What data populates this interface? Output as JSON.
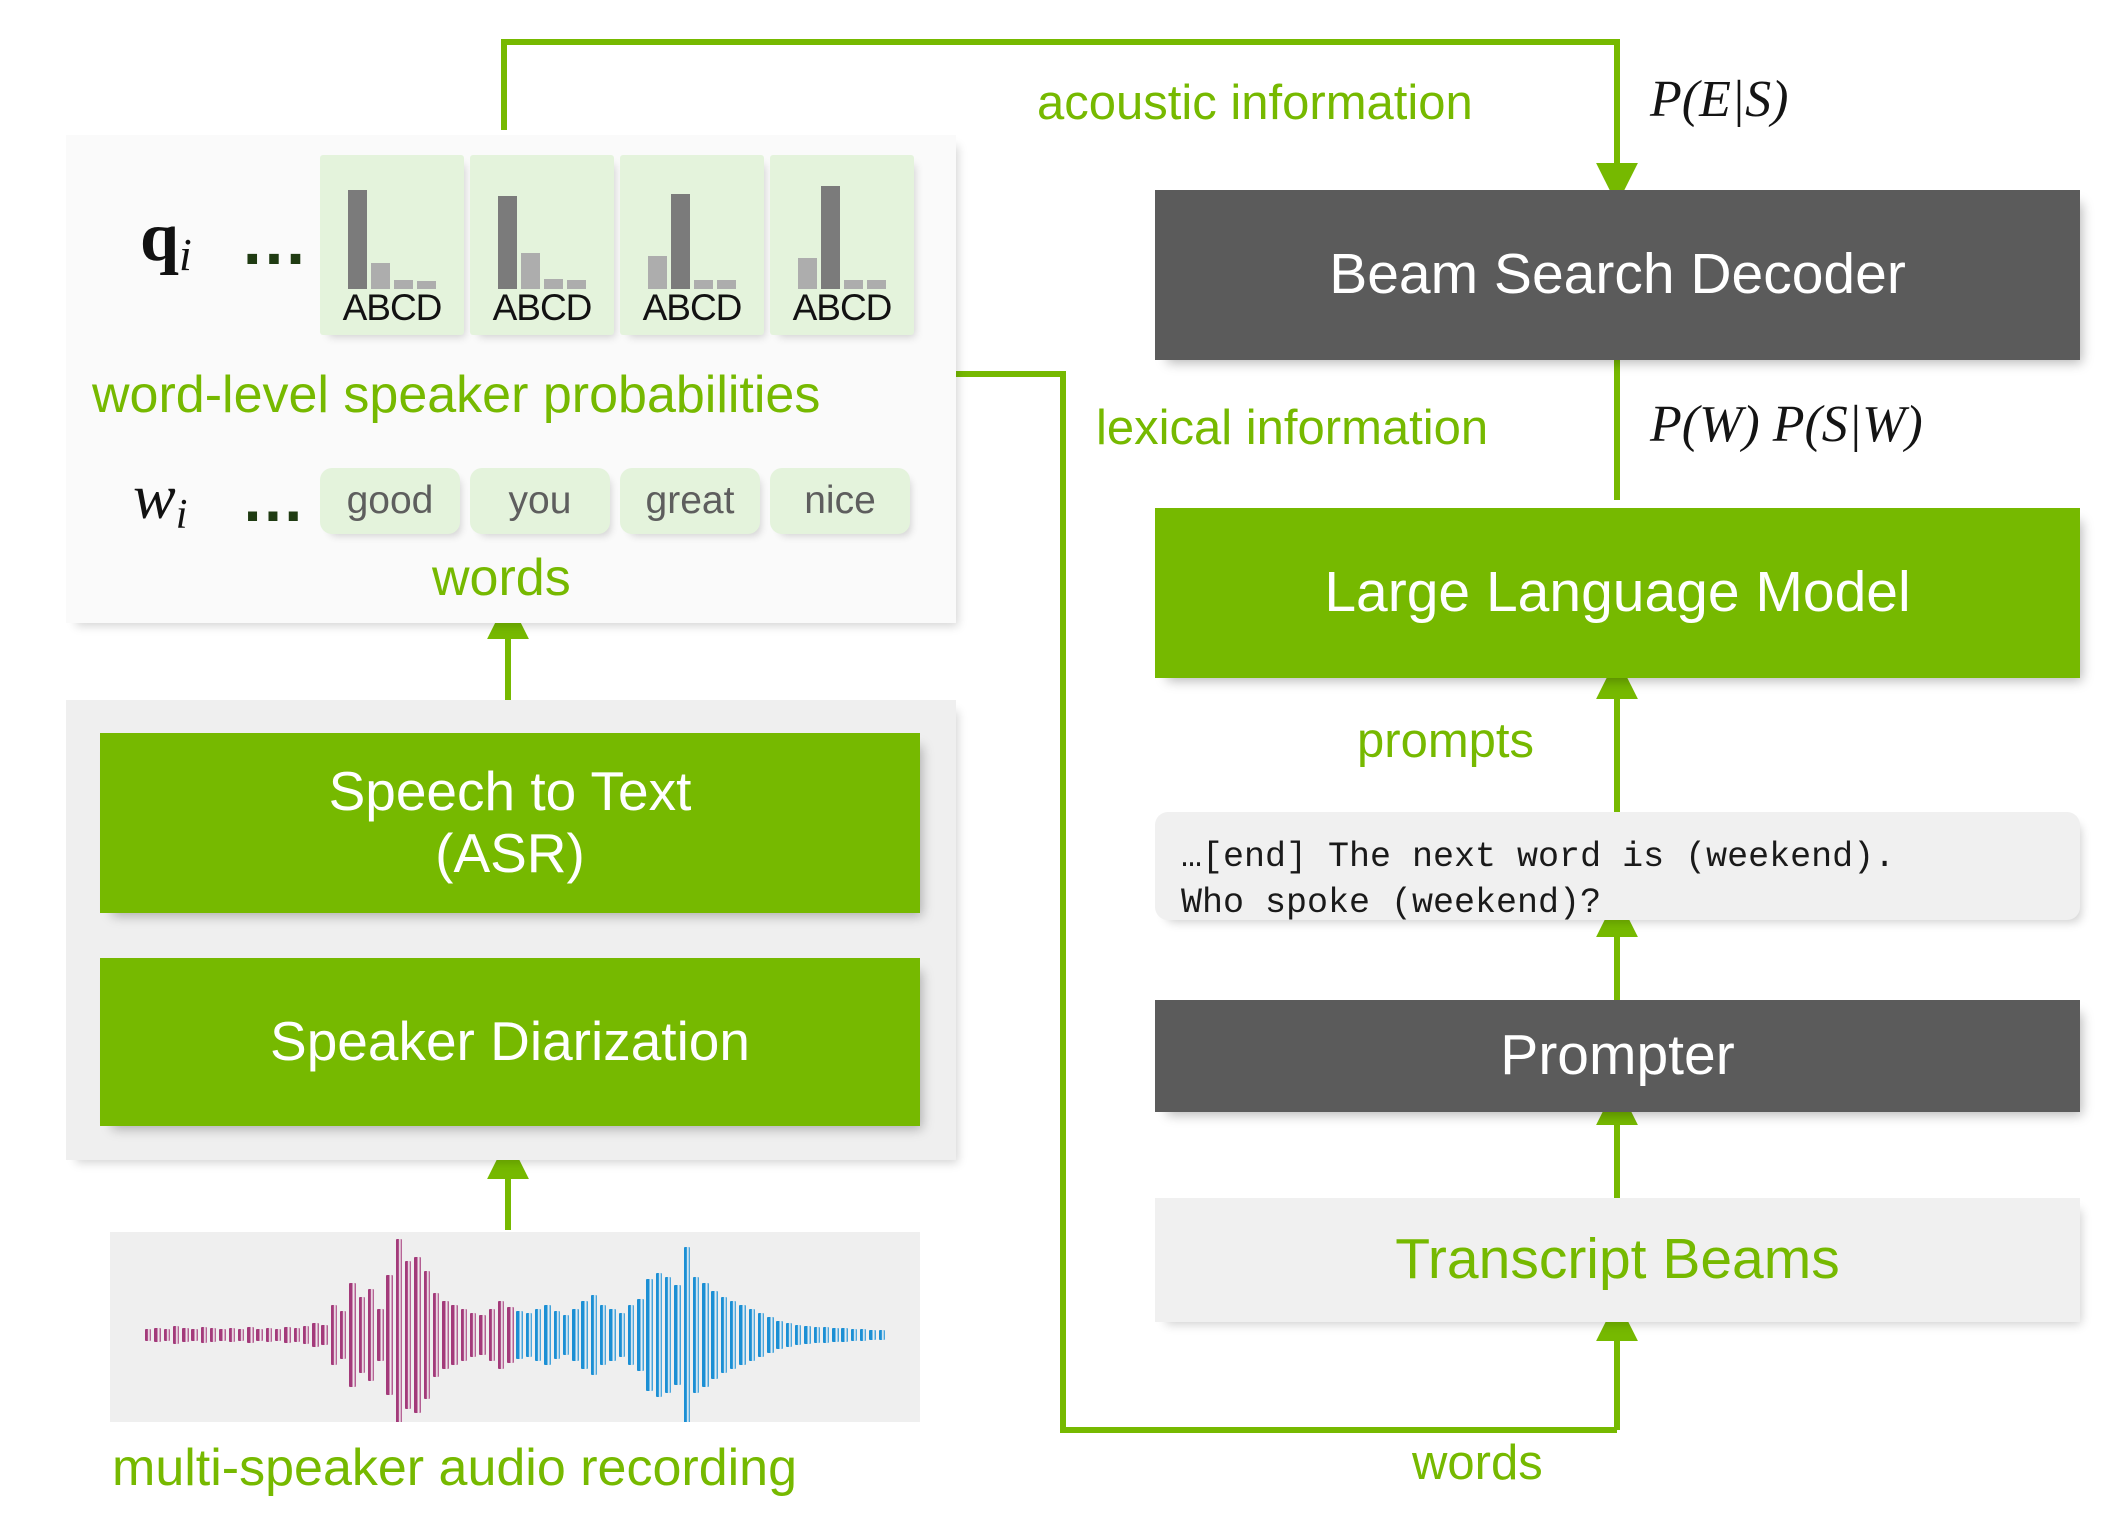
{
  "colors": {
    "green": "#76B900",
    "dark_box": "#5B5B5B",
    "pale_chip": "#E4F3DC",
    "panel_grey": "#EFEFEF",
    "bar_high": "#7B7B7B",
    "bar_low": "#ADADAD",
    "wave_speaker_a": "#A33A7A",
    "wave_speaker_b": "#1B8FD4"
  },
  "left_column": {
    "outputs_panel": {
      "q_symbol": "q",
      "q_subscript": "i",
      "q_ellipsis": "…",
      "w_symbol": "w",
      "w_subscript": "i",
      "w_ellipsis": "…",
      "probabilities_caption": "word-level speaker probabilities",
      "words_caption": "words",
      "histogram_axis_label": "ABCD",
      "word_chips": [
        "good",
        "you",
        "great",
        "nice"
      ]
    },
    "pipeline": {
      "speech_to_text_line1": "Speech to Text",
      "speech_to_text_line2": "(ASR)",
      "speaker_diarization": "Speaker Diarization"
    },
    "audio": {
      "caption": "multi-speaker audio recording"
    }
  },
  "right_column": {
    "beam_search_decoder": "Beam Search Decoder",
    "large_language_model": "Large Language Model",
    "prompter": "Prompter",
    "transcript_beams": "Transcript Beams",
    "prompt_text_line1": "…[end] The next word is (weekend).",
    "prompt_text_line2": "Who spoke (weekend)?"
  },
  "edge_labels": {
    "acoustic_information": "acoustic information",
    "acoustic_formula": "P(E|S)",
    "lexical_information": "lexical information",
    "lexical_formula": "P(W) P(S|W)",
    "prompts": "prompts",
    "words": "words"
  },
  "chart_data": {
    "type": "bar",
    "title": "word-level speaker probabilities",
    "categories": [
      "A",
      "B",
      "C",
      "D"
    ],
    "ylim": [
      0,
      1
    ],
    "grid": false,
    "legend": "none",
    "charts": [
      {
        "word": "good",
        "values": [
          0.92,
          0.24,
          0.07,
          0.06
        ],
        "argmax": "A"
      },
      {
        "word": "you",
        "values": [
          0.86,
          0.33,
          0.08,
          0.07
        ],
        "argmax": "A"
      },
      {
        "word": "great",
        "values": [
          0.3,
          0.88,
          0.07,
          0.07
        ],
        "argmax": "B"
      },
      {
        "word": "nice",
        "values": [
          0.28,
          0.95,
          0.07,
          0.07
        ],
        "argmax": "B"
      }
    ]
  }
}
